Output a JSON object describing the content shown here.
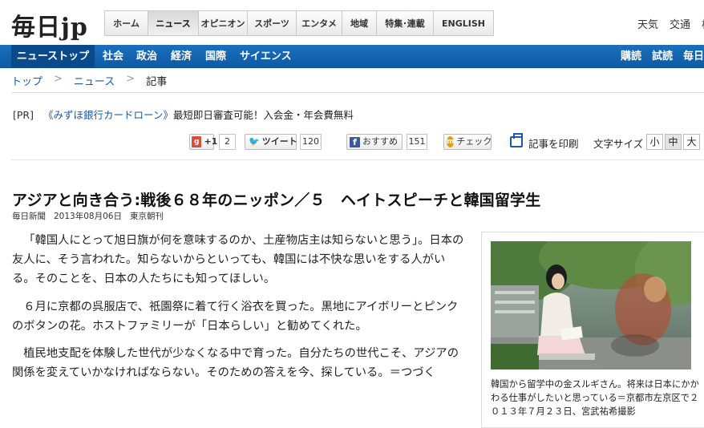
{
  "logo": "毎日jp",
  "topnav": [
    "ホーム",
    "ニュース",
    "オピニオン",
    "スポーツ",
    "エンタメ",
    "地域",
    "特集･連載",
    "ENGLISH"
  ],
  "topright": [
    "天気",
    "交通",
    "株"
  ],
  "bluebar": {
    "left": [
      "ニューストップ",
      "社会",
      "政治",
      "経済",
      "国際",
      "サイエンス"
    ],
    "right": [
      "購読",
      "試読",
      "毎日新"
    ]
  },
  "breadcrumb": [
    "トップ",
    "ニュース",
    "記事"
  ],
  "pr": {
    "label": "[PR]",
    "link": "《みずほ銀行カードローン》",
    "rest": "最短即日審査可能！入会金・年会費無料"
  },
  "social": {
    "gplus_label": "+1",
    "gplus_count": "2",
    "tweet_label": "ツイート",
    "tweet_count": "120",
    "fb_label": "おすすめ",
    "fb_count": "151",
    "mixi_label": "チェック",
    "print_label": "記事を印刷",
    "fontsize_label": "文字サイズ",
    "fontsizes": [
      "小",
      "中",
      "大"
    ],
    "fontsize_selected": "中"
  },
  "article": {
    "title": "アジアと向き合う:戦後６８年のニッポン／５　ヘイトスピーチと韓国留学生",
    "source": "毎日新聞",
    "date": "2013年08月06日",
    "edition": "東京朝刊",
    "paragraphs": [
      "「韓国人にとって旭日旗が何を意味するのか、土産物店主は知らないと思う」。日本の友人に、そう言われた。知らないからといっても、韓国には不快な思いをする人がいる。そのことを、日本の人たちにも知ってほしい。",
      "６月に京都の呉服店で、祇園祭に着て行く浴衣を買った。黒地にアイボリーとピンクのボタンの花。ホストファミリーが「日本らしい」と勧めてくれた。",
      "植民地支配を体験した世代が少なくなる中で育った。自分たちの世代こそ、アジアの関係を変えていかなければならない。そのための答えを今、探している。＝つづく"
    ],
    "caption": "韓国から留学中の金スルギさん。将来は日本にかかわる仕事がしたいと思っている＝京都市左京区で２０１３年７月２３日、宮武祐希撮影"
  },
  "colors": {
    "nav_blue": "#1565b3",
    "link_blue": "#1a5aa8"
  }
}
